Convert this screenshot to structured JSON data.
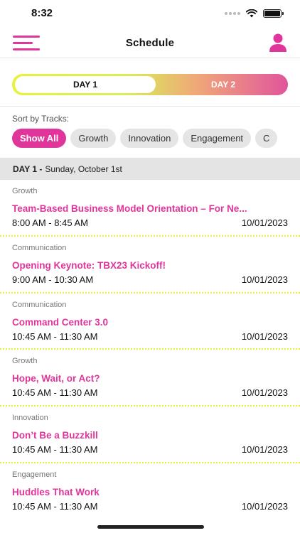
{
  "status_bar": {
    "time": "8:32"
  },
  "header": {
    "title": "Schedule"
  },
  "day_toggle": {
    "day1": "DAY 1",
    "day2": "DAY 2"
  },
  "sort": {
    "label": "Sort by Tracks:",
    "chips": [
      "Show All",
      "Growth",
      "Innovation",
      "Engagement",
      "C"
    ]
  },
  "day_header": {
    "day": "DAY 1 -",
    "date": "Sunday, October 1st"
  },
  "sessions": [
    {
      "track": "Growth",
      "title": "Team-Based Business Model Orientation – For Ne...",
      "time": "8:00 AM - 8:45 AM",
      "date": "10/01/2023"
    },
    {
      "track": "Communication",
      "title": "Opening Keynote: TBX23 Kickoff!",
      "time": "9:00 AM - 10:30 AM",
      "date": "10/01/2023"
    },
    {
      "track": "Communication",
      "title": "Command Center 3.0",
      "time": "10:45 AM - 11:30 AM",
      "date": "10/01/2023"
    },
    {
      "track": "Growth",
      "title": "Hope, Wait, or Act?",
      "time": "10:45 AM - 11:30 AM",
      "date": "10/01/2023"
    },
    {
      "track": "Innovation",
      "title": "Don’t Be a Buzzkill",
      "time": "10:45 AM - 11:30 AM",
      "date": "10/01/2023"
    },
    {
      "track": "Engagement",
      "title": "Huddles That Work",
      "time": "10:45 AM - 11:30 AM",
      "date": "10/01/2023"
    }
  ],
  "colors": {
    "accent": "#e0359b",
    "separator": "#e6ef3e"
  },
  "icons": [
    "hamburger-menu-icon",
    "user-profile-icon",
    "wifi-icon",
    "battery-icon",
    "signal-icon"
  ]
}
